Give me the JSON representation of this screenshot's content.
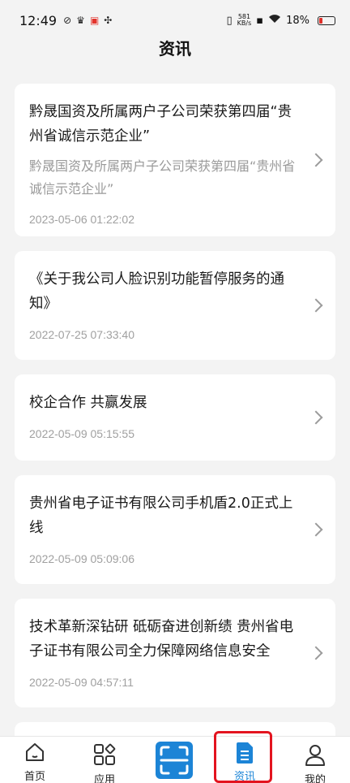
{
  "status_bar": {
    "time": "12:49",
    "net_speed_value": "581",
    "net_speed_unit": "KB/s",
    "battery": "18%"
  },
  "page": {
    "title": "资讯"
  },
  "news": [
    {
      "title": "黔晟国资及所属两户子公司荣获第四届“贵州省诚信示范企业”",
      "desc": "黔晟国资及所属两户子公司荣获第四届“贵州省诚信示范企业”",
      "date": "2023-05-06 01:22:02"
    },
    {
      "title": "《关于我公司人脸识别功能暂停服务的通知》",
      "desc": "",
      "date": "2022-07-25 07:33:40"
    },
    {
      "title": "校企合作 共赢发展",
      "desc": "",
      "date": "2022-05-09 05:15:55"
    },
    {
      "title": "贵州省电子证书有限公司手机盾2.0正式上线",
      "desc": "",
      "date": "2022-05-09 05:09:06"
    },
    {
      "title": "技术革新深钻研 砥砺奋进创新绩 贵州省电子证书有限公司全力保障网络信息安全",
      "desc": "",
      "date": "2022-05-09 04:57:11"
    }
  ],
  "tabs": {
    "home": "首页",
    "apps": "应用",
    "news": "资讯",
    "mine": "我的"
  },
  "colors": {
    "accent": "#1c84d6",
    "highlight": "#e3141f"
  },
  "icons": {
    "home": "home-icon",
    "apps": "apps-grid-icon",
    "scan": "scan-icon",
    "news": "document-icon",
    "mine": "user-icon"
  }
}
